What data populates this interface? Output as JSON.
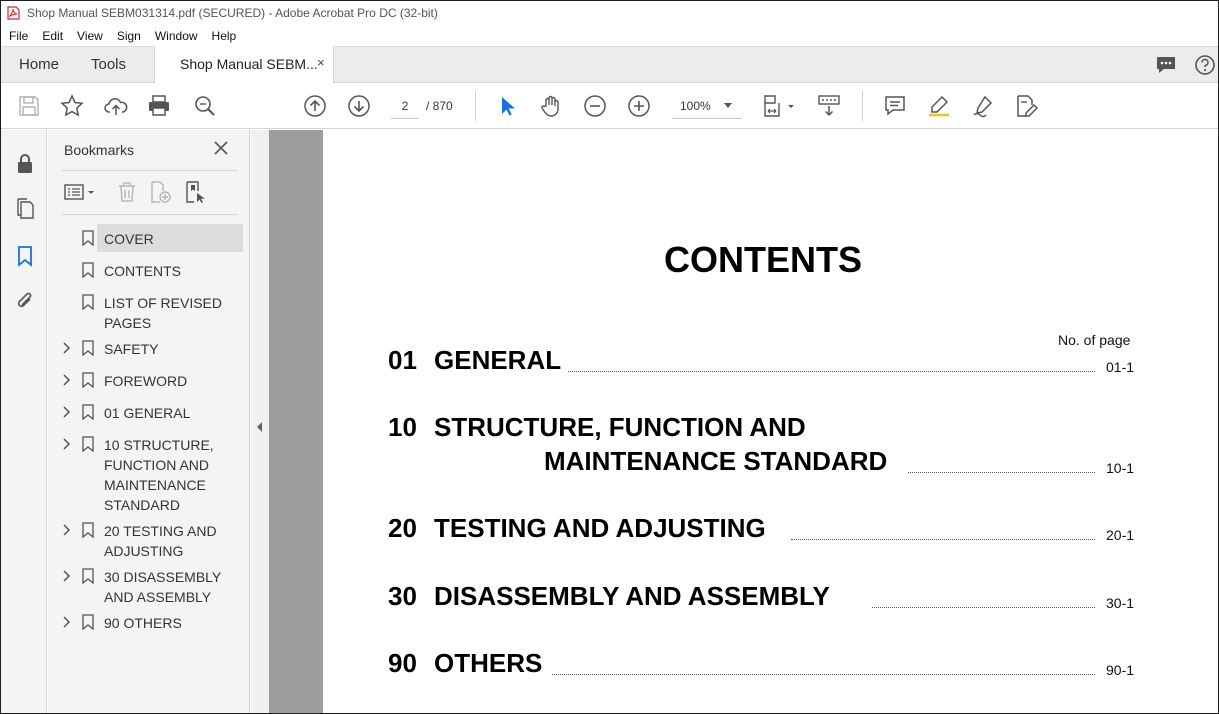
{
  "window": {
    "title": "Shop Manual SEBM031314.pdf (SECURED) - Adobe Acrobat Pro DC (32-bit)"
  },
  "menu": [
    "File",
    "Edit",
    "View",
    "Sign",
    "Window",
    "Help"
  ],
  "tabs": {
    "home": "Home",
    "tools": "Tools",
    "document": "Shop Manual SEBM...",
    "close": "×"
  },
  "toolbar": {
    "page_current": "2",
    "page_total": "/ 870",
    "zoom": "100%"
  },
  "bookmarks": {
    "title": "Bookmarks",
    "items": [
      {
        "label": "COVER",
        "expandable": false,
        "selected": true
      },
      {
        "label": "CONTENTS",
        "expandable": false
      },
      {
        "label": "LIST OF REVISED PAGES",
        "expandable": false
      },
      {
        "label": "SAFETY",
        "expandable": true
      },
      {
        "label": "FOREWORD",
        "expandable": true
      },
      {
        "label": "01 GENERAL",
        "expandable": true
      },
      {
        "label": "10 STRUCTURE, FUNCTION AND MAINTENANCE STANDARD",
        "expandable": true
      },
      {
        "label": "20 TESTING AND ADJUSTING",
        "expandable": true
      },
      {
        "label": "30 DISASSEMBLY AND ASSEMBLY",
        "expandable": true
      },
      {
        "label": "90 OTHERS",
        "expandable": true
      }
    ]
  },
  "document": {
    "title": "CONTENTS",
    "page_header": "No. of page",
    "entries": [
      {
        "number": "01",
        "text": "GENERAL",
        "page": "01-1"
      },
      {
        "number": "10",
        "text": "STRUCTURE, FUNCTION AND",
        "text2": "MAINTENANCE STANDARD",
        "page": "10-1"
      },
      {
        "number": "20",
        "text": "TESTING AND ADJUSTING",
        "page": "20-1"
      },
      {
        "number": "30",
        "text": "DISASSEMBLY AND ASSEMBLY",
        "page": "30-1"
      },
      {
        "number": "90",
        "text": "OTHERS",
        "page": "90-1"
      }
    ]
  },
  "colors": {
    "accent": "#1473e6",
    "gray_margin": "#9d9d9d",
    "pdf_red": "#d7262b"
  }
}
